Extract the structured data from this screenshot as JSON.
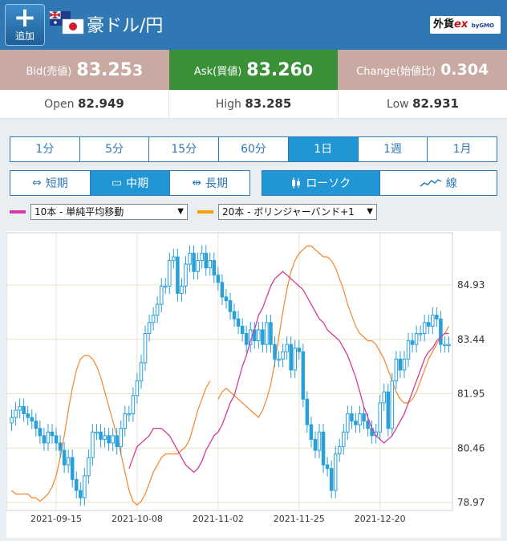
{
  "header": {
    "add_label": "追加",
    "pair_title": "豪ドル/円",
    "brand_prefix": "外貨",
    "brand_ex": "ex",
    "brand_gmo": "byGMO"
  },
  "quotes": {
    "bid_label": "Bid(売値)",
    "bid_main": "83.25",
    "bid_tail": "3",
    "ask_label": "Ask(買値)",
    "ask_main": "83.26",
    "ask_tail": "0",
    "change_label": "Change(始値比)",
    "change_value": "0.304",
    "colors": {
      "bid": "#c9aaa2",
      "ask": "#3a9137",
      "change": "#c9aaa2"
    }
  },
  "ohl": {
    "open_label": "Open",
    "open_value": "82.949",
    "high_label": "High",
    "high_value": "83.285",
    "low_label": "Low",
    "low_value": "82.931"
  },
  "timeframes": [
    {
      "label": "1分",
      "active": false
    },
    {
      "label": "5分",
      "active": false
    },
    {
      "label": "15分",
      "active": false
    },
    {
      "label": "60分",
      "active": false
    },
    {
      "label": "1日",
      "active": true
    },
    {
      "label": "1週",
      "active": false
    },
    {
      "label": "1月",
      "active": false
    }
  ],
  "period_toggle": [
    {
      "label": "短期",
      "icon": "arrows-horizontal-icon",
      "active": false
    },
    {
      "label": "中期",
      "icon": "rectangle-icon",
      "active": true
    },
    {
      "label": "長期",
      "icon": "arrows-outward-icon",
      "active": false
    }
  ],
  "chart_type_toggle": [
    {
      "label": "ローソク",
      "icon": "candlestick-icon",
      "active": true
    },
    {
      "label": "線",
      "icon": "line-chart-icon",
      "active": false
    }
  ],
  "indicators": {
    "ma": {
      "color": "#d23ca8",
      "selected": "10本 - 単純平均移動"
    },
    "bb": {
      "color": "#f0a400",
      "selected": "20本 - ボリンジャーバンド+1"
    }
  },
  "chart_data": {
    "type": "candlestick",
    "y_ticks": [
      "84.93",
      "83.44",
      "81.95",
      "80.46",
      "78.97"
    ],
    "y_tick_values": [
      84.93,
      83.44,
      81.95,
      80.46,
      78.97
    ],
    "ylim": [
      78.75,
      86.36
    ],
    "x_ticks": [
      "2021-09-15",
      "2021-10-08",
      "2021-11-02",
      "2021-11-25",
      "2021-12-20"
    ],
    "x_tick_index": [
      11,
      31,
      51,
      71,
      91
    ],
    "candle_color": "#29a0d8",
    "ma_color": "#d23ca8",
    "bb_color": "#f5842a",
    "grid": true,
    "closes": [
      81.3,
      81.5,
      81.6,
      81.4,
      81.3,
      81.2,
      81.0,
      80.8,
      80.6,
      80.9,
      80.8,
      80.6,
      80.4,
      80.0,
      80.2,
      79.6,
      79.3,
      79.1,
      79.7,
      80.2,
      80.9,
      80.9,
      80.7,
      80.8,
      80.6,
      80.8,
      80.5,
      81.0,
      81.4,
      81.4,
      81.9,
      82.3,
      82.8,
      83.6,
      83.9,
      84.1,
      84.4,
      84.9,
      84.9,
      85.6,
      85.7,
      84.7,
      84.9,
      85.5,
      85.8,
      85.3,
      85.6,
      85.8,
      85.4,
      85.6,
      85.2,
      85.0,
      84.6,
      84.5,
      84.2,
      84.0,
      83.8,
      83.6,
      83.3,
      83.7,
      83.4,
      83.7,
      83.3,
      83.9,
      83.3,
      82.9,
      82.9,
      83.1,
      83.3,
      82.6,
      83.2,
      83.1,
      81.8,
      81.1,
      80.7,
      80.4,
      80.9,
      80.0,
      79.9,
      79.3,
      80.3,
      80.5,
      80.9,
      81.4,
      81.2,
      81.1,
      81.4,
      81.2,
      81.0,
      80.8,
      80.9,
      81.7,
      82.0,
      81.0,
      82.3,
      82.9,
      82.6,
      82.9,
      83.4,
      83.3,
      83.6,
      83.6,
      83.9,
      83.8,
      84.1,
      84.0,
      83.3,
      83.3,
      83.3
    ],
    "ma10": [
      79.9,
      80.2,
      80.5,
      80.6,
      80.7,
      80.8,
      81.0,
      81.0,
      81.0,
      80.9,
      80.8,
      80.6,
      80.4,
      80.2,
      80.0,
      79.9,
      79.8,
      79.9,
      80.1,
      80.4,
      80.6,
      80.8,
      80.9,
      81.1,
      81.4,
      81.7,
      81.9,
      82.3,
      82.7,
      83.0,
      83.4,
      83.7,
      84.1,
      84.3,
      84.6,
      84.9,
      85.1,
      85.2,
      85.3,
      85.2,
      85.1,
      85.0,
      84.9,
      84.8,
      84.6,
      84.4,
      84.2,
      84.0,
      83.9,
      83.7,
      83.6,
      83.5,
      83.4,
      83.2,
      83.0,
      82.7,
      82.4,
      82.0,
      81.6,
      81.3,
      81.0,
      80.8,
      80.7,
      80.6,
      80.7,
      80.8,
      81.0,
      81.2,
      81.4,
      81.7,
      82.0,
      82.3,
      82.6,
      82.9,
      83.1,
      83.2,
      83.4,
      83.5,
      83.6,
      83.6
    ],
    "bb_upper": [
      81.8,
      82.0,
      82.1,
      82.0,
      81.9,
      81.8,
      81.7,
      81.6,
      81.5,
      81.4,
      81.3,
      81.5,
      81.8,
      82.2,
      82.8,
      83.5,
      84.2,
      84.8,
      85.3,
      85.6,
      85.8,
      85.9,
      86.0,
      86.0,
      85.9,
      85.8,
      85.7,
      85.7,
      85.6,
      85.4,
      85.1,
      84.8,
      84.4,
      84.1,
      83.8,
      83.6,
      83.5,
      83.4,
      83.4,
      83.3,
      83.1,
      82.9,
      82.6,
      82.3,
      82.0,
      81.8,
      81.7,
      81.7,
      81.8,
      82.0,
      82.3,
      82.6,
      82.9,
      83.1,
      83.3,
      83.5,
      83.6,
      83.8
    ],
    "bb_lower": [
      79.3,
      79.2,
      79.2,
      79.2,
      79.2,
      79.1,
      79.1,
      79.0,
      79.1,
      79.2,
      79.4,
      79.7,
      80.2,
      80.8,
      81.5,
      82.1,
      82.6,
      82.9,
      83.0,
      83.0,
      82.9,
      82.7,
      82.4,
      82.0,
      81.6,
      81.2,
      80.8,
      80.3,
      79.8,
      79.3,
      79.0,
      78.9,
      79.0,
      79.2,
      79.5,
      79.8,
      80.0,
      80.2,
      80.3,
      80.3,
      80.3,
      80.3,
      80.4,
      80.5,
      80.7,
      81.1,
      81.5,
      81.8,
      82.1,
      82.3
    ]
  }
}
